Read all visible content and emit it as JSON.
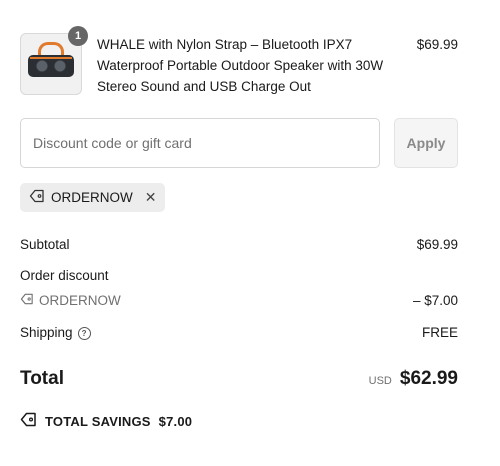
{
  "product": {
    "quantity": "1",
    "title": "WHALE with Nylon Strap – Bluetooth IPX7 Waterproof Portable Outdoor Speaker with 30W Stereo Sound and USB Charge Out",
    "price": "$69.99"
  },
  "discount": {
    "placeholder": "Discount code or gift card",
    "value": "",
    "apply_label": "Apply",
    "applied_code": "ORDERNOW"
  },
  "summary": {
    "subtotal_label": "Subtotal",
    "subtotal_value": "$69.99",
    "order_discount_label": "Order discount",
    "discount_code": "ORDERNOW",
    "discount_value": "– $7.00",
    "shipping_label": "Shipping",
    "shipping_value": "FREE",
    "total_label": "Total",
    "currency": "USD",
    "total_value": "$62.99",
    "savings_label": "TOTAL SAVINGS",
    "savings_value": "$7.00"
  },
  "colors": {
    "text": "#1a1a1a",
    "muted": "#707070",
    "badge": "#666666",
    "tag_bg": "#ededed"
  }
}
